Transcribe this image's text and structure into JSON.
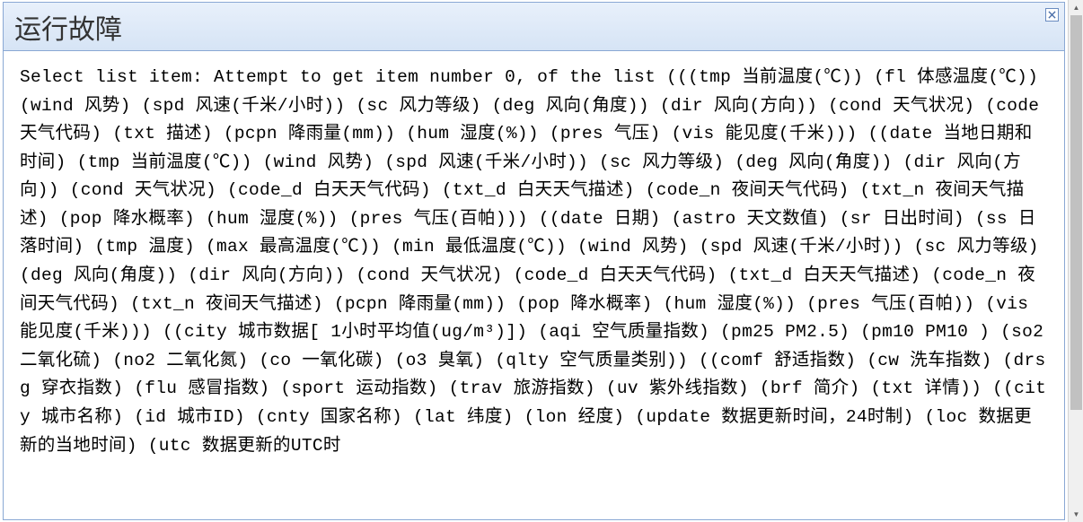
{
  "dialog": {
    "title": "运行故障",
    "message": "Select list item: Attempt to get item number 0, of the list (((tmp 当前温度(℃)) (fl 体感温度(℃)) (wind 风势) (spd 风速(千米/小时)) (sc 风力等级) (deg 风向(角度)) (dir 风向(方向)) (cond 天气状况) (code 天气代码) (txt 描述) (pcpn 降雨量(mm)) (hum 湿度(%)) (pres 气压) (vis 能见度(千米))) ((date 当地日期和时间) (tmp 当前温度(℃)) (wind 风势) (spd 风速(千米/小时)) (sc 风力等级) (deg 风向(角度)) (dir 风向(方向)) (cond 天气状况) (code_d 白天天气代码) (txt_d 白天天气描述) (code_n 夜间天气代码) (txt_n 夜间天气描述) (pop 降水概率) (hum 湿度(%)) (pres 气压(百帕))) ((date 日期) (astro 天文数值) (sr 日出时间) (ss 日落时间) (tmp 温度) (max 最高温度(℃)) (min 最低温度(℃)) (wind 风势) (spd 风速(千米/小时)) (sc 风力等级) (deg 风向(角度)) (dir 风向(方向)) (cond 天气状况) (code_d 白天天气代码) (txt_d 白天天气描述) (code_n 夜间天气代码) (txt_n 夜间天气描述) (pcpn 降雨量(mm)) (pop 降水概率) (hum 湿度(%)) (pres 气压(百帕)) (vis 能见度(千米))) ((city 城市数据[ 1小时平均值(ug/m³)]) (aqi 空气质量指数) (pm25 PM2.5) (pm10 PM10 ) (so2 二氧化硫) (no2 二氧化氮) (co 一氧化碳) (o3 臭氧) (qlty 空气质量类别)) ((comf 舒适指数) (cw 洗车指数) (drsg 穿衣指数) (flu 感冒指数) (sport 运动指数) (trav 旅游指数) (uv 紫外线指数) (brf 简介) (txt 详情)) ((city 城市名称) (id 城市ID) (cnty 国家名称) (lat 纬度) (lon 经度) (update 数据更新时间，24时制) (loc 数据更新的当地时间) (utc 数据更新的UTC时"
  }
}
